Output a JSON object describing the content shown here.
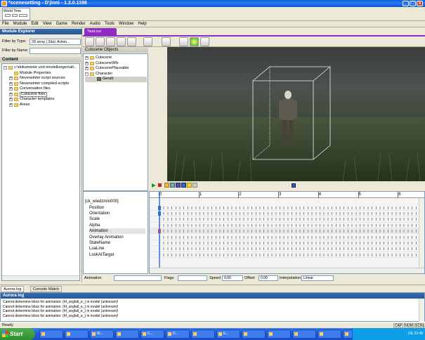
{
  "window": {
    "title": "*scenesetting - D'jinni - 1.3.0.1198",
    "min": "_",
    "max": "□",
    "close": "x"
  },
  "world_time": {
    "label": "World Time"
  },
  "menu": [
    "File",
    "Module",
    "Edit",
    "View",
    "Game",
    "Render",
    "Audio",
    "Tools",
    "Window",
    "Help"
  ],
  "module_explorer": {
    "title": "Module Explorer",
    "filter_type_label": "Filter by Type:",
    "filter_type_value": "2D array (.2da); Action...",
    "filter_name_label": "Filter by Name:",
    "filter_name_value": "",
    "content_title": "Content",
    "tree": [
      {
        "label": "c:\\dokumente und einstellungen\\all...",
        "indent": 0,
        "expander": "-"
      },
      {
        "label": "Module Properties",
        "indent": 1,
        "expander": ""
      },
      {
        "label": "Neverwinter script sources",
        "indent": 1,
        "expander": "+"
      },
      {
        "label": "Neverwinter compiled scripts",
        "indent": 1,
        "expander": "+"
      },
      {
        "label": "Conversation files",
        "indent": 1,
        "expander": "+"
      },
      {
        "label": "Cutscene files",
        "indent": 1,
        "expander": "+",
        "selected": true
      },
      {
        "label": "Character templates",
        "indent": 1,
        "expander": "+"
      },
      {
        "label": "Areas",
        "indent": 1,
        "expander": "+"
      }
    ]
  },
  "tab": {
    "label": "*test.cut"
  },
  "cutscene_objects": {
    "title": "Cutscene Objects",
    "tree": [
      {
        "label": "Cutscene",
        "indent": 0,
        "expander": "+"
      },
      {
        "label": "CutsceneWfx",
        "indent": 0,
        "expander": "+"
      },
      {
        "label": "CutscenePlaceable",
        "indent": 0,
        "expander": "+"
      },
      {
        "label": "Character",
        "indent": 0,
        "expander": "-"
      },
      {
        "label": "Geralt",
        "indent": 1,
        "expander": "",
        "selected": true
      }
    ]
  },
  "timeline": {
    "root": "[ck_wiedzmin000]",
    "tracks": [
      "Position",
      "Orientation",
      "Scale",
      "Alpha",
      "Animation",
      "Overlay Animation",
      "StateName",
      "LuaLine",
      "LookAtTarget"
    ],
    "highlighted_track": "Animation",
    "ruler": [
      "0",
      "1",
      "2",
      "3",
      "4",
      "5",
      "6"
    ]
  },
  "props": {
    "animation_label": "Animation",
    "flags_label": "Flags",
    "speed_label": "Speed",
    "speed_value": "0.00",
    "offset_label": "Offset",
    "offset_value": "0.00",
    "interpolation_label": "Interpolation",
    "interpolation_value": "Linear"
  },
  "bottom_tabs": [
    "Aurora log",
    "Console Watch"
  ],
  "aurora_log": {
    "title": "Aurora log",
    "lines": [
      "Cannot determine bbox for animation: (hf_zegfall_e_) in model (unknown)!",
      "Cannot determine bbox for animation: (hf_zegfall_e_) in model (unknown)!",
      "Cannot determine bbox for animation: (hf_zegfall_e_) in model (unknown)!",
      "Cannot determine bbox for animation: (hf_zegfall_e_) in model (unknown)!"
    ]
  },
  "status": {
    "text": "Ready",
    "cap": "CAP",
    "num": "NUM",
    "scrl": "SCRL"
  },
  "taskbar": {
    "start": "Start",
    "tasks": [
      "",
      "",
      "W...",
      "",
      "C...",
      "D...",
      "",
      "E...",
      "",
      "",
      "",
      "",
      ""
    ],
    "tray": "DE  22:48"
  },
  "colors": {
    "title": "#0a5fe0",
    "panel_header": "#3a6ea5",
    "tab": "#8c2fc0",
    "taskbar": "#2157d8",
    "start": "#2f8f2f"
  }
}
